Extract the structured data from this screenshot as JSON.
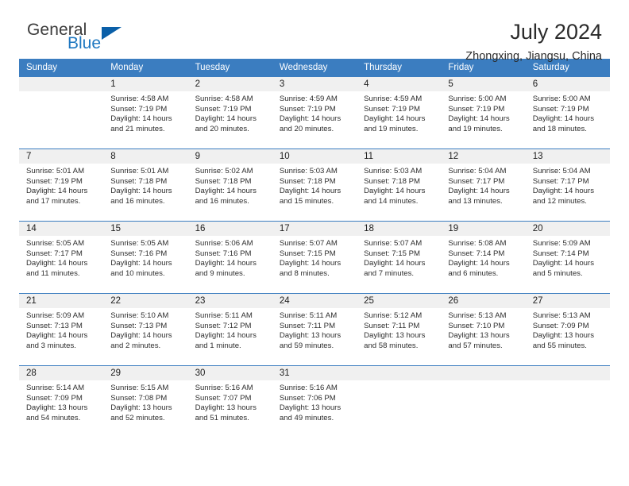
{
  "brand": {
    "name_part1": "General",
    "name_part2": "Blue",
    "logo_icon": "triangle-logo-icon",
    "accent_color": "#0a5fa8"
  },
  "header": {
    "title": "July 2024",
    "subtitle": "Zhongxing, Jiangsu, China"
  },
  "calendar": {
    "header_background": "#3b7dc0",
    "day_band_background": "#f0f0f0",
    "weekday_headers": [
      "Sunday",
      "Monday",
      "Tuesday",
      "Wednesday",
      "Thursday",
      "Friday",
      "Saturday"
    ],
    "weeks": [
      [
        {
          "date": "",
          "sunrise": "",
          "sunset": "",
          "daylight_line1": "",
          "daylight_line2": ""
        },
        {
          "date": "1",
          "sunrise": "Sunrise: 4:58 AM",
          "sunset": "Sunset: 7:19 PM",
          "daylight_line1": "Daylight: 14 hours",
          "daylight_line2": "and 21 minutes."
        },
        {
          "date": "2",
          "sunrise": "Sunrise: 4:58 AM",
          "sunset": "Sunset: 7:19 PM",
          "daylight_line1": "Daylight: 14 hours",
          "daylight_line2": "and 20 minutes."
        },
        {
          "date": "3",
          "sunrise": "Sunrise: 4:59 AM",
          "sunset": "Sunset: 7:19 PM",
          "daylight_line1": "Daylight: 14 hours",
          "daylight_line2": "and 20 minutes."
        },
        {
          "date": "4",
          "sunrise": "Sunrise: 4:59 AM",
          "sunset": "Sunset: 7:19 PM",
          "daylight_line1": "Daylight: 14 hours",
          "daylight_line2": "and 19 minutes."
        },
        {
          "date": "5",
          "sunrise": "Sunrise: 5:00 AM",
          "sunset": "Sunset: 7:19 PM",
          "daylight_line1": "Daylight: 14 hours",
          "daylight_line2": "and 19 minutes."
        },
        {
          "date": "6",
          "sunrise": "Sunrise: 5:00 AM",
          "sunset": "Sunset: 7:19 PM",
          "daylight_line1": "Daylight: 14 hours",
          "daylight_line2": "and 18 minutes."
        }
      ],
      [
        {
          "date": "7",
          "sunrise": "Sunrise: 5:01 AM",
          "sunset": "Sunset: 7:19 PM",
          "daylight_line1": "Daylight: 14 hours",
          "daylight_line2": "and 17 minutes."
        },
        {
          "date": "8",
          "sunrise": "Sunrise: 5:01 AM",
          "sunset": "Sunset: 7:18 PM",
          "daylight_line1": "Daylight: 14 hours",
          "daylight_line2": "and 16 minutes."
        },
        {
          "date": "9",
          "sunrise": "Sunrise: 5:02 AM",
          "sunset": "Sunset: 7:18 PM",
          "daylight_line1": "Daylight: 14 hours",
          "daylight_line2": "and 16 minutes."
        },
        {
          "date": "10",
          "sunrise": "Sunrise: 5:03 AM",
          "sunset": "Sunset: 7:18 PM",
          "daylight_line1": "Daylight: 14 hours",
          "daylight_line2": "and 15 minutes."
        },
        {
          "date": "11",
          "sunrise": "Sunrise: 5:03 AM",
          "sunset": "Sunset: 7:18 PM",
          "daylight_line1": "Daylight: 14 hours",
          "daylight_line2": "and 14 minutes."
        },
        {
          "date": "12",
          "sunrise": "Sunrise: 5:04 AM",
          "sunset": "Sunset: 7:17 PM",
          "daylight_line1": "Daylight: 14 hours",
          "daylight_line2": "and 13 minutes."
        },
        {
          "date": "13",
          "sunrise": "Sunrise: 5:04 AM",
          "sunset": "Sunset: 7:17 PM",
          "daylight_line1": "Daylight: 14 hours",
          "daylight_line2": "and 12 minutes."
        }
      ],
      [
        {
          "date": "14",
          "sunrise": "Sunrise: 5:05 AM",
          "sunset": "Sunset: 7:17 PM",
          "daylight_line1": "Daylight: 14 hours",
          "daylight_line2": "and 11 minutes."
        },
        {
          "date": "15",
          "sunrise": "Sunrise: 5:05 AM",
          "sunset": "Sunset: 7:16 PM",
          "daylight_line1": "Daylight: 14 hours",
          "daylight_line2": "and 10 minutes."
        },
        {
          "date": "16",
          "sunrise": "Sunrise: 5:06 AM",
          "sunset": "Sunset: 7:16 PM",
          "daylight_line1": "Daylight: 14 hours",
          "daylight_line2": "and 9 minutes."
        },
        {
          "date": "17",
          "sunrise": "Sunrise: 5:07 AM",
          "sunset": "Sunset: 7:15 PM",
          "daylight_line1": "Daylight: 14 hours",
          "daylight_line2": "and 8 minutes."
        },
        {
          "date": "18",
          "sunrise": "Sunrise: 5:07 AM",
          "sunset": "Sunset: 7:15 PM",
          "daylight_line1": "Daylight: 14 hours",
          "daylight_line2": "and 7 minutes."
        },
        {
          "date": "19",
          "sunrise": "Sunrise: 5:08 AM",
          "sunset": "Sunset: 7:14 PM",
          "daylight_line1": "Daylight: 14 hours",
          "daylight_line2": "and 6 minutes."
        },
        {
          "date": "20",
          "sunrise": "Sunrise: 5:09 AM",
          "sunset": "Sunset: 7:14 PM",
          "daylight_line1": "Daylight: 14 hours",
          "daylight_line2": "and 5 minutes."
        }
      ],
      [
        {
          "date": "21",
          "sunrise": "Sunrise: 5:09 AM",
          "sunset": "Sunset: 7:13 PM",
          "daylight_line1": "Daylight: 14 hours",
          "daylight_line2": "and 3 minutes."
        },
        {
          "date": "22",
          "sunrise": "Sunrise: 5:10 AM",
          "sunset": "Sunset: 7:13 PM",
          "daylight_line1": "Daylight: 14 hours",
          "daylight_line2": "and 2 minutes."
        },
        {
          "date": "23",
          "sunrise": "Sunrise: 5:11 AM",
          "sunset": "Sunset: 7:12 PM",
          "daylight_line1": "Daylight: 14 hours",
          "daylight_line2": "and 1 minute."
        },
        {
          "date": "24",
          "sunrise": "Sunrise: 5:11 AM",
          "sunset": "Sunset: 7:11 PM",
          "daylight_line1": "Daylight: 13 hours",
          "daylight_line2": "and 59 minutes."
        },
        {
          "date": "25",
          "sunrise": "Sunrise: 5:12 AM",
          "sunset": "Sunset: 7:11 PM",
          "daylight_line1": "Daylight: 13 hours",
          "daylight_line2": "and 58 minutes."
        },
        {
          "date": "26",
          "sunrise": "Sunrise: 5:13 AM",
          "sunset": "Sunset: 7:10 PM",
          "daylight_line1": "Daylight: 13 hours",
          "daylight_line2": "and 57 minutes."
        },
        {
          "date": "27",
          "sunrise": "Sunrise: 5:13 AM",
          "sunset": "Sunset: 7:09 PM",
          "daylight_line1": "Daylight: 13 hours",
          "daylight_line2": "and 55 minutes."
        }
      ],
      [
        {
          "date": "28",
          "sunrise": "Sunrise: 5:14 AM",
          "sunset": "Sunset: 7:09 PM",
          "daylight_line1": "Daylight: 13 hours",
          "daylight_line2": "and 54 minutes."
        },
        {
          "date": "29",
          "sunrise": "Sunrise: 5:15 AM",
          "sunset": "Sunset: 7:08 PM",
          "daylight_line1": "Daylight: 13 hours",
          "daylight_line2": "and 52 minutes."
        },
        {
          "date": "30",
          "sunrise": "Sunrise: 5:16 AM",
          "sunset": "Sunset: 7:07 PM",
          "daylight_line1": "Daylight: 13 hours",
          "daylight_line2": "and 51 minutes."
        },
        {
          "date": "31",
          "sunrise": "Sunrise: 5:16 AM",
          "sunset": "Sunset: 7:06 PM",
          "daylight_line1": "Daylight: 13 hours",
          "daylight_line2": "and 49 minutes."
        },
        {
          "date": "",
          "sunrise": "",
          "sunset": "",
          "daylight_line1": "",
          "daylight_line2": ""
        },
        {
          "date": "",
          "sunrise": "",
          "sunset": "",
          "daylight_line1": "",
          "daylight_line2": ""
        },
        {
          "date": "",
          "sunrise": "",
          "sunset": "",
          "daylight_line1": "",
          "daylight_line2": ""
        }
      ]
    ]
  }
}
